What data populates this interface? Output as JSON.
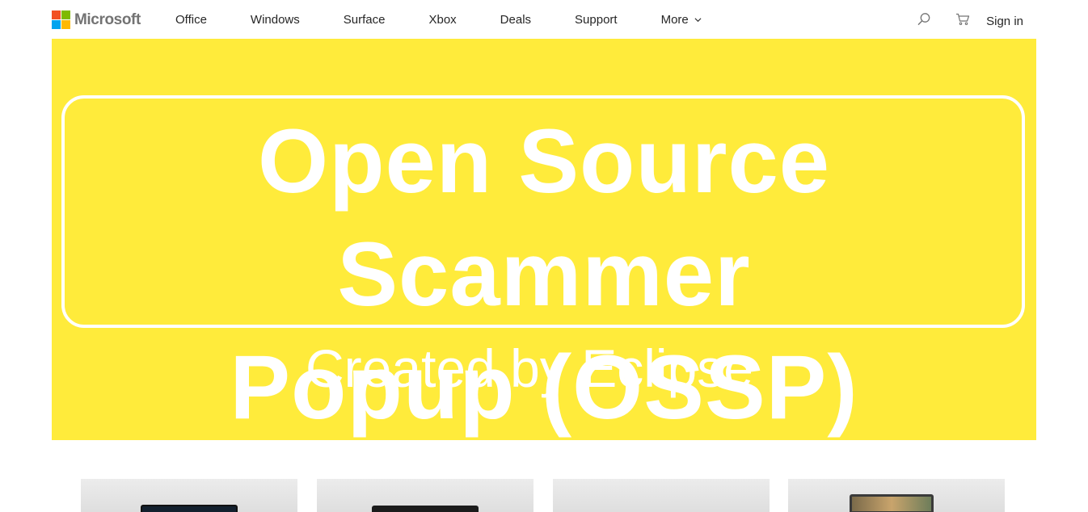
{
  "header": {
    "logo_text": "Microsoft",
    "logo_colors": [
      "#f25022",
      "#7fba00",
      "#00a4ef",
      "#ffb900"
    ],
    "nav": [
      {
        "label": "Office"
      },
      {
        "label": "Windows"
      },
      {
        "label": "Surface"
      },
      {
        "label": "Xbox"
      },
      {
        "label": "Deals"
      },
      {
        "label": "Support"
      },
      {
        "label": "More",
        "has_dropdown": true
      }
    ],
    "search_icon": "search-icon",
    "cart_icon": "cart-icon",
    "signin_label": "Sign in"
  },
  "hero": {
    "background_color": "#ffeb3b",
    "title_line1": "Open Source Scammer",
    "title_line2": "Popup (OSSP)",
    "subtitle": "Created by Eclipse"
  },
  "products": [
    {
      "name": "product-card-laptop"
    },
    {
      "name": "product-card-tablet"
    },
    {
      "name": "product-card-blank"
    },
    {
      "name": "product-card-monitor"
    }
  ]
}
